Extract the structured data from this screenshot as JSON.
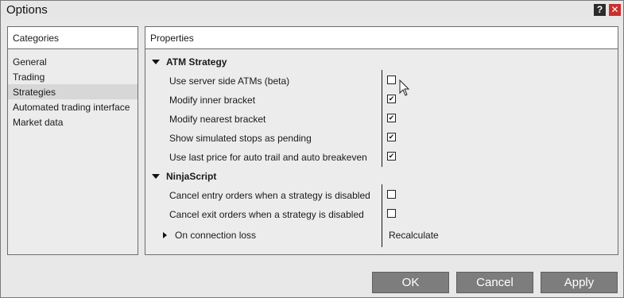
{
  "window": {
    "title": "Options"
  },
  "titlebar": {
    "help_label": "?",
    "close_label": "✕"
  },
  "categories": {
    "header": "Categories",
    "items": [
      {
        "label": "General"
      },
      {
        "label": "Trading"
      },
      {
        "label": "Strategies"
      },
      {
        "label": "Automated trading interface"
      },
      {
        "label": "Market data"
      }
    ],
    "selected": "Strategies"
  },
  "properties": {
    "header": "Properties",
    "sections": [
      {
        "title": "ATM Strategy",
        "rows": [
          {
            "label": "Use server side ATMs (beta)",
            "checked": false
          },
          {
            "label": "Modify inner bracket",
            "checked": true
          },
          {
            "label": "Modify nearest bracket",
            "checked": true
          },
          {
            "label": "Show simulated stops as pending",
            "checked": true
          },
          {
            "label": "Use last price for auto trail and auto breakeven",
            "checked": true
          }
        ]
      },
      {
        "title": "NinjaScript",
        "rows": [
          {
            "label": "Cancel entry orders when a strategy is disabled",
            "checked": false
          },
          {
            "label": "Cancel exit orders when a strategy is disabled",
            "checked": false
          }
        ],
        "subgroup": {
          "label": "On connection loss",
          "value": "Recalculate"
        }
      }
    ]
  },
  "buttons": {
    "ok": "OK",
    "cancel": "Cancel",
    "apply": "Apply"
  },
  "colors": {
    "button_bg": "#7d7d7d",
    "close_bg": "#c9302c",
    "selected_bg": "#d7d7d7"
  }
}
